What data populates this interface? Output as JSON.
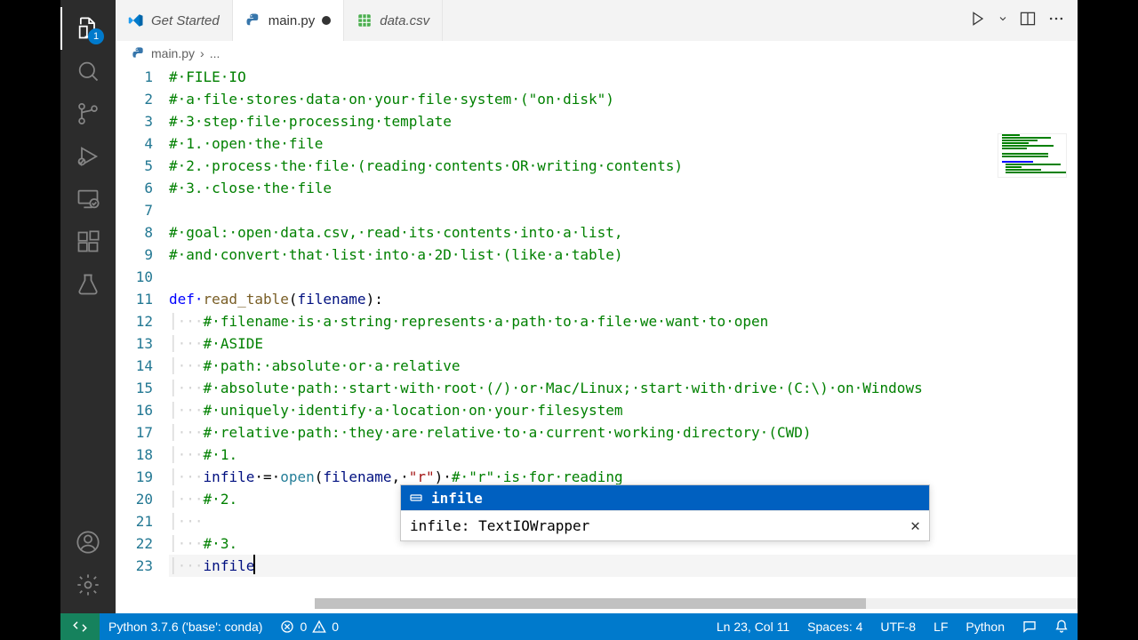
{
  "activity": {
    "explorer_badge": "1"
  },
  "tabs": [
    {
      "label": "Get Started",
      "icon": "vscode",
      "italic": true
    },
    {
      "label": "main.py",
      "icon": "python",
      "dirty": true
    },
    {
      "label": "data.csv",
      "icon": "csv"
    }
  ],
  "breadcrumb": {
    "file": "main.py",
    "sep": "›",
    "more": "..."
  },
  "lines": [
    {
      "n": 1,
      "indent": 0,
      "segs": [
        {
          "t": "# FILE IO",
          "c": "comment"
        }
      ]
    },
    {
      "n": 2,
      "indent": 0,
      "segs": [
        {
          "t": "# a file stores data on your file system (\"on disk\")",
          "c": "comment"
        }
      ]
    },
    {
      "n": 3,
      "indent": 0,
      "segs": [
        {
          "t": "# 3 step file processing template",
          "c": "comment"
        }
      ]
    },
    {
      "n": 4,
      "indent": 0,
      "segs": [
        {
          "t": "# 1. open the file",
          "c": "comment"
        }
      ]
    },
    {
      "n": 5,
      "indent": 0,
      "segs": [
        {
          "t": "# 2. process the file (reading contents OR writing contents)",
          "c": "comment"
        }
      ]
    },
    {
      "n": 6,
      "indent": 0,
      "segs": [
        {
          "t": "# 3. close the file",
          "c": "comment"
        }
      ]
    },
    {
      "n": 7,
      "indent": 0,
      "segs": []
    },
    {
      "n": 8,
      "indent": 0,
      "segs": [
        {
          "t": "# goal: open data.csv, read its contents into a list,",
          "c": "comment"
        }
      ]
    },
    {
      "n": 9,
      "indent": 0,
      "segs": [
        {
          "t": "# and convert that list into a 2D list (like a table)",
          "c": "comment"
        }
      ]
    },
    {
      "n": 10,
      "indent": 0,
      "segs": []
    },
    {
      "n": 11,
      "indent": 0,
      "segs": [
        {
          "t": "def ",
          "c": "keyword"
        },
        {
          "t": "read_table",
          "c": "func"
        },
        {
          "t": "(",
          "c": "punc"
        },
        {
          "t": "filename",
          "c": "var"
        },
        {
          "t": "):",
          "c": "punc"
        }
      ]
    },
    {
      "n": 12,
      "indent": 1,
      "segs": [
        {
          "t": "# filename is a string represents a path to a file we want to open",
          "c": "comment"
        }
      ]
    },
    {
      "n": 13,
      "indent": 1,
      "segs": [
        {
          "t": "# ASIDE",
          "c": "comment"
        }
      ]
    },
    {
      "n": 14,
      "indent": 1,
      "segs": [
        {
          "t": "# path: absolute or a relative",
          "c": "comment"
        }
      ]
    },
    {
      "n": 15,
      "indent": 1,
      "segs": [
        {
          "t": "# absolute path: start with root (/) or Mac/Linux; start with drive (C:\\) on Windows",
          "c": "comment"
        }
      ]
    },
    {
      "n": 16,
      "indent": 1,
      "segs": [
        {
          "t": "# uniquely identify a location on your filesystem",
          "c": "comment"
        }
      ]
    },
    {
      "n": 17,
      "indent": 1,
      "segs": [
        {
          "t": "# relative path: they are relative to a current working directory (CWD)",
          "c": "comment"
        }
      ]
    },
    {
      "n": 18,
      "indent": 1,
      "segs": [
        {
          "t": "# 1.",
          "c": "comment"
        }
      ]
    },
    {
      "n": 19,
      "indent": 1,
      "segs": [
        {
          "t": "infile",
          "c": "var"
        },
        {
          "t": " = ",
          "c": "punc"
        },
        {
          "t": "open",
          "c": "builtin"
        },
        {
          "t": "(",
          "c": "punc"
        },
        {
          "t": "filename",
          "c": "var"
        },
        {
          "t": ", ",
          "c": "punc"
        },
        {
          "t": "\"r\"",
          "c": "string"
        },
        {
          "t": ") ",
          "c": "punc"
        },
        {
          "t": "# \"r\" is for reading",
          "c": "comment"
        }
      ]
    },
    {
      "n": 20,
      "indent": 1,
      "segs": [
        {
          "t": "# 2.",
          "c": "comment"
        }
      ]
    },
    {
      "n": 21,
      "indent": 1,
      "segs": []
    },
    {
      "n": 22,
      "indent": 1,
      "segs": [
        {
          "t": "# 3.",
          "c": "comment"
        }
      ]
    },
    {
      "n": 23,
      "indent": 1,
      "current": true,
      "segs": [
        {
          "t": "infile",
          "c": "var"
        }
      ],
      "cursor": true
    }
  ],
  "autocomplete": {
    "items": [
      {
        "label": "infile",
        "kind": "variable",
        "selected": true
      }
    ],
    "detail": "infile: TextIOWrapper"
  },
  "status": {
    "interpreter": "Python 3.7.6 ('base': conda)",
    "errors": "0",
    "warnings": "0",
    "cursor": "Ln 23, Col 11",
    "spaces": "Spaces: 4",
    "encoding": "UTF-8",
    "eol": "LF",
    "language": "Python"
  }
}
